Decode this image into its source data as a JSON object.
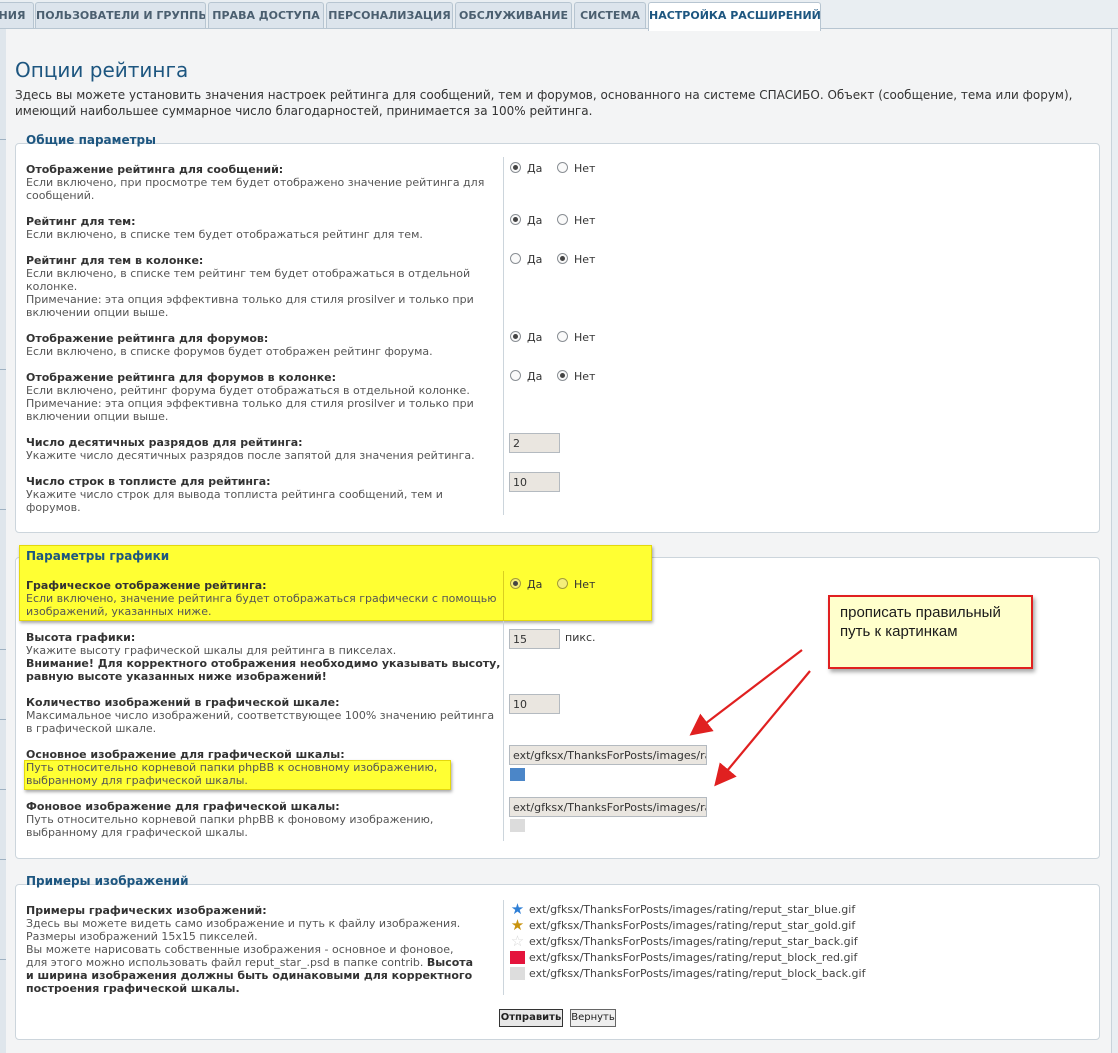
{
  "tabs": [
    {
      "label": "НИЯ"
    },
    {
      "label": "ПОЛЬЗОВАТЕЛИ И ГРУППЫ"
    },
    {
      "label": "ПРАВА ДОСТУПА"
    },
    {
      "label": "ПЕРСОНАЛИЗАЦИЯ"
    },
    {
      "label": "ОБСЛУЖИВАНИЕ"
    },
    {
      "label": "СИСТЕМА"
    },
    {
      "label": "НАСТРОЙКА РАСШИРЕНИЙ"
    }
  ],
  "page": {
    "title": "Опции рейтинга",
    "intro": "Здесь вы можете установить значения настроек рейтинга для сообщений, тем и форумов, основанного на системе СПАСИБО. Объект (сообщение, тема или форум), имеющий наибольшее суммарное число благодарностей, принимается за 100% рейтинга."
  },
  "yes_label": "Да",
  "no_label": "Нет",
  "general": {
    "legend": "Общие параметры",
    "posts_rating": {
      "label": "Отображение рейтинга для сообщений:",
      "desc": "Если включено, при просмотре тем будет отображено значение рейтинга для сообщений.",
      "value": "yes"
    },
    "topics_rating": {
      "label": "Рейтинг для тем:",
      "desc": "Если включено, в списке тем будет отображаться рейтинг для тем.",
      "value": "yes"
    },
    "topics_column": {
      "label": "Рейтинг для тем в колонке:",
      "desc": "Если включено, в списке тем рейтинг тем будет отображаться в отдельной колонке.",
      "note": "Примечание: эта опция эффективна только для стиля prosilver и только при включении опции выше.",
      "value": "no"
    },
    "forums_rating": {
      "label": "Отображение рейтинга для форумов:",
      "desc": "Если включено, в списке форумов будет отображен рейтинг форума.",
      "value": "yes"
    },
    "forums_column": {
      "label": "Отображение рейтинга для форумов в колонке:",
      "desc": "Если включено, рейтинг форума будет отображаться в отдельной колонке.",
      "note": "Примечание: эта опция эффективна только для стиля prosilver и только при включении опции выше.",
      "value": "no"
    },
    "decimals": {
      "label": "Число десятичных разрядов для рейтинга:",
      "desc": "Укажите число десятичных разрядов после запятой для значения рейтинга.",
      "value": "2"
    },
    "toplist_rows": {
      "label": "Число строк в топлисте для рейтинга:",
      "desc": "Укажите число строк для вывода топлиста рейтинга сообщений, тем и форумов.",
      "value": "10"
    }
  },
  "graphics": {
    "legend": "Параметры графики",
    "graphic_display": {
      "label": "Графическое отображение рейтинга:",
      "desc": "Если включено, значение рейтинга будет отображаться графически с помощью изображений, указанных ниже.",
      "value": "yes"
    },
    "height": {
      "label": "Высота графики:",
      "desc": "Укажите высоту графической шкалы для рейтинга в пикселах.",
      "warning": "Внимание! Для корректного отображения необходимо указывать высоту, равную высоте указанных ниже изображений!",
      "value": "15",
      "unit": "пикс."
    },
    "count": {
      "label": "Количество изображений в графической шкале:",
      "desc": "Максимальное число изображений, соответствующее 100% значению рейтинга в графической шкале.",
      "value": "10"
    },
    "main_image": {
      "label": "Основное изображение для графической шкалы:",
      "desc": "Путь относительно корневой папки phpBB к основному изображению, выбранному для графической шкалы.",
      "value": "ext/gfksx/ThanksForPosts/images/rating/reput_block_blue.gif",
      "swatch_color": "#4b86c8"
    },
    "back_image": {
      "label": "Фоновое изображение для графической шкалы:",
      "desc": "Путь относительно корневой папки phpBB к фоновому изображению, выбранному для графической шкалы.",
      "value": "ext/gfksx/ThanksForPosts/images/rating/reput_block_back.gif",
      "swatch_color": "#dcdcdc"
    }
  },
  "examples": {
    "legend": "Примеры изображений",
    "label": "Примеры графических изображений:",
    "desc1": "Здесь вы можете видеть само изображение и путь к файлу изображения.",
    "desc2": "Размеры изображений 15x15 пикселей.",
    "desc3": "Вы можете нарисовать собственные изображения - основное и фоновое, для этого можно использовать файл reput_star_.psd в папке contrib.",
    "desc_bold": "Высота и ширина изображения должны быть одинаковыми для корректного построения графической шкалы.",
    "items": [
      {
        "icon": "star-blue-icon",
        "color": "#2f7fd6",
        "path": "ext/gfksx/ThanksForPosts/images/rating/reput_star_blue.gif"
      },
      {
        "icon": "star-gold-icon",
        "color": "#c9930e",
        "path": "ext/gfksx/ThanksForPosts/images/rating/reput_star_gold.gif"
      },
      {
        "icon": "star-back-icon",
        "color": "#d8d8d8",
        "path": "ext/gfksx/ThanksForPosts/images/rating/reput_star_back.gif"
      },
      {
        "icon": "block-red-icon",
        "color": "#e4143c",
        "path": "ext/gfksx/ThanksForPosts/images/rating/reput_block_red.gif"
      },
      {
        "icon": "block-back-icon",
        "color": "#dddddd",
        "path": "ext/gfksx/ThanksForPosts/images/rating/reput_block_back.gif"
      }
    ]
  },
  "buttons": {
    "submit": "Отправить",
    "reset": "Вернуть"
  },
  "callout": {
    "text": "прописать правильный путь к картинкам",
    "border_color": "#e02020",
    "arrow_color": "#e02020"
  },
  "colors": {
    "accent": "#1d5680",
    "highlight": "#ffff33"
  }
}
